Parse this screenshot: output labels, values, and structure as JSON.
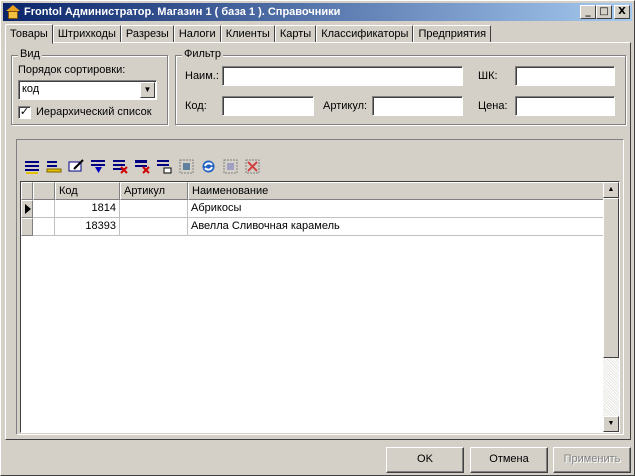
{
  "window": {
    "title": "Frontol Администратор. Магазин 1 ( база 1 ).  Справочники",
    "minimize": "_",
    "maximize": "□",
    "close": "X"
  },
  "tabs": [
    {
      "label": "Товары",
      "active": true
    },
    {
      "label": "Штрихкоды"
    },
    {
      "label": "Разрезы"
    },
    {
      "label": "Налоги"
    },
    {
      "label": "Клиенты"
    },
    {
      "label": "Карты"
    },
    {
      "label": "Классификаторы"
    },
    {
      "label": "Предприятия"
    }
  ],
  "view_group": {
    "title": "Вид",
    "sort_label": "Порядок сортировки:",
    "sort_value": "код",
    "hierarchical_label": "Иерархический список",
    "hierarchical_checked": "✓"
  },
  "filter_group": {
    "title": "Фильтр",
    "name_label": "Наим.:",
    "barcode_label": "ШК:",
    "code_label": "Код:",
    "article_label": "Артикул:",
    "price_label": "Цена:",
    "name_value": "",
    "barcode_value": "",
    "code_value": "",
    "article_value": "",
    "price_value": ""
  },
  "toolbar": [
    "add-record-icon",
    "edit-record-icon",
    "edit-field-icon",
    "copy-record-icon",
    "delete-record-icon",
    "delete-marked-icon",
    "new-group-icon",
    "select-all-icon",
    "refresh-icon",
    "mark-icon",
    "unmark-icon"
  ],
  "grid": {
    "columns": [
      "Код",
      "Артикул",
      "Наименование"
    ],
    "rows": [
      {
        "code": "1814",
        "article": "",
        "name": "Абрикосы"
      },
      {
        "code": "18393",
        "article": "",
        "name": "Авелла Сливочная карамель"
      }
    ]
  },
  "buttons": {
    "ok": "OK",
    "cancel": "Отмена",
    "apply": "Применить"
  },
  "colors": {
    "titlebar_start": "#0a246a",
    "titlebar_end": "#a6caf0",
    "face": "#d4d0c8"
  }
}
